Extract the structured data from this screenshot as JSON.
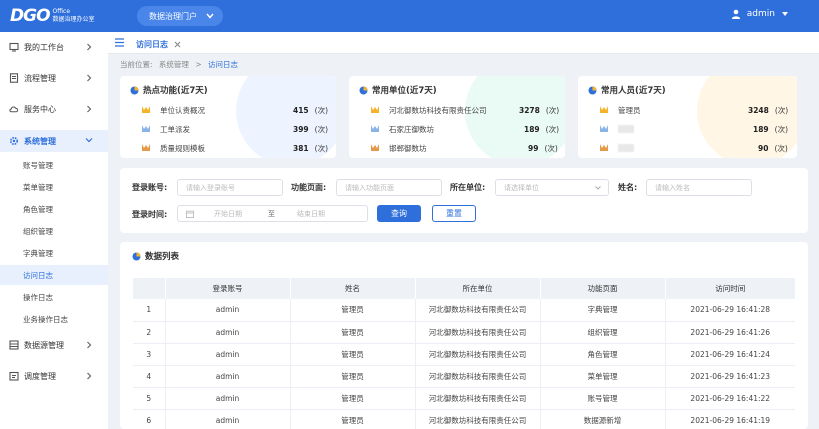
{
  "header": {
    "logo_text": "DGO",
    "logo_sub1": "Office",
    "logo_sub2": "数据治理办公室",
    "portal_label": "数据治理门户",
    "username": "admin"
  },
  "tab": {
    "label": "访问日志"
  },
  "sidebar": {
    "items": [
      {
        "label": "我的工作台"
      },
      {
        "label": "流程管理"
      },
      {
        "label": "服务中心"
      },
      {
        "label": "系统管理"
      },
      {
        "label": "数据源管理"
      },
      {
        "label": "调度管理"
      }
    ],
    "sub_items": [
      {
        "label": "账号管理"
      },
      {
        "label": "菜单管理"
      },
      {
        "label": "角色管理"
      },
      {
        "label": "组织管理"
      },
      {
        "label": "字典管理"
      },
      {
        "label": "访问日志"
      },
      {
        "label": "操作日志"
      },
      {
        "label": "业务操作日志"
      }
    ]
  },
  "breadcrumb": {
    "prefix": "当前位置:",
    "parent": "系统管理",
    "sep": ">",
    "current": "访问日志"
  },
  "cards": [
    {
      "title": "热点功能(近7天)",
      "rows": [
        {
          "name": "单位认责概况",
          "count": "415",
          "unit": "(次)"
        },
        {
          "name": "工单派发",
          "count": "399",
          "unit": "(次)"
        },
        {
          "name": "质量规则模板",
          "count": "381",
          "unit": "(次)"
        }
      ]
    },
    {
      "title": "常用单位(近7天)",
      "rows": [
        {
          "name": "河北御数坊科技有限责任公司",
          "count": "3278",
          "unit": "(次)"
        },
        {
          "name": "石家庄御数坊",
          "count": "189",
          "unit": "(次)"
        },
        {
          "name": "邯郸御数坊",
          "count": "99",
          "unit": "(次)"
        }
      ]
    },
    {
      "title": "常用人员(近7天)",
      "rows": [
        {
          "name": "管理员",
          "count": "3248",
          "unit": "(次)"
        },
        {
          "name": "",
          "count": "189",
          "unit": "(次)"
        },
        {
          "name": "",
          "count": "90",
          "unit": "(次)"
        }
      ]
    }
  ],
  "filter": {
    "account_label": "登录账号:",
    "account_placeholder": "请输入登录账号",
    "page_label": "功能页面:",
    "page_placeholder": "请输入功能页面",
    "unit_label": "所在单位:",
    "unit_placeholder": "请选择单位",
    "name_label": "姓名:",
    "name_placeholder": "请输入姓名",
    "time_label": "登录时间:",
    "start_placeholder": "开始日期",
    "range_sep": "至",
    "end_placeholder": "结束日期",
    "query_btn": "查询",
    "reset_btn": "重置"
  },
  "table": {
    "title": "数据列表",
    "columns": [
      "",
      "登录账号",
      "姓名",
      "所在单位",
      "功能页面",
      "访问时间"
    ],
    "rows": [
      [
        "1",
        "admin",
        "管理员",
        "河北御数坊科技有限责任公司",
        "字典管理",
        "2021-06-29 16:41:28"
      ],
      [
        "2",
        "admin",
        "管理员",
        "河北御数坊科技有限责任公司",
        "组织管理",
        "2021-06-29 16:41:26"
      ],
      [
        "3",
        "admin",
        "管理员",
        "河北御数坊科技有限责任公司",
        "角色管理",
        "2021-06-29 16:41:24"
      ],
      [
        "4",
        "admin",
        "管理员",
        "河北御数坊科技有限责任公司",
        "菜单管理",
        "2021-06-29 16:41:23"
      ],
      [
        "5",
        "admin",
        "管理员",
        "河北御数坊科技有限责任公司",
        "账号管理",
        "2021-06-29 16:41:22"
      ],
      [
        "6",
        "admin",
        "管理员",
        "河北御数坊科技有限责任公司",
        "数据源新增",
        "2021-06-29 16:41:19"
      ]
    ]
  },
  "colors": {
    "primary": "#2f6fdc",
    "gold": "#f5b32b",
    "blue_medal": "#8ab4e8",
    "bronze": "#e39b4a"
  }
}
